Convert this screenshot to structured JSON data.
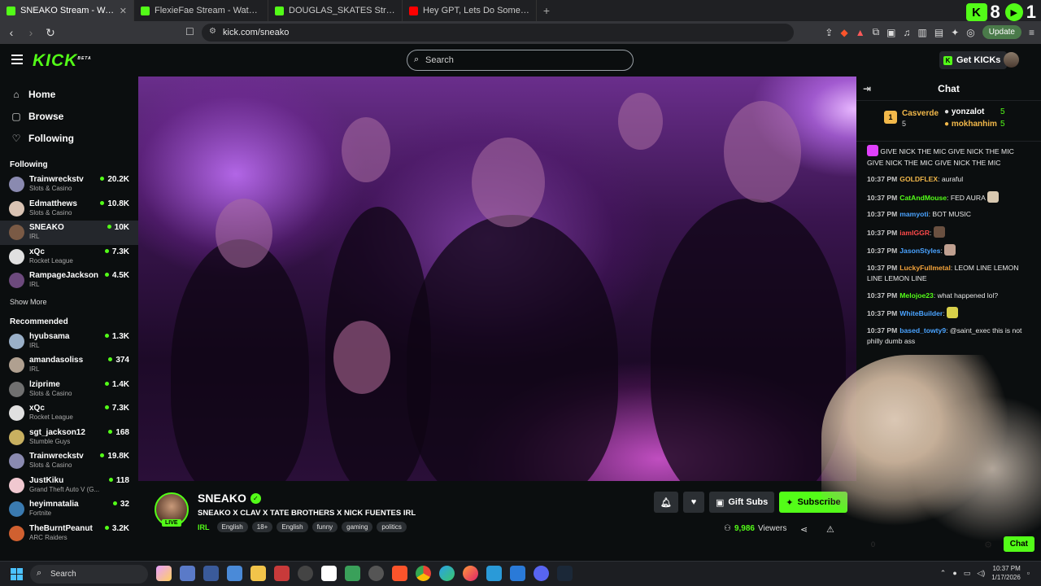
{
  "browser": {
    "tabs": [
      {
        "title": "SNEAKO Stream - Watch Live",
        "fav": "#53fc18",
        "active": true
      },
      {
        "title": "FlexieFae Stream - Watch Live on Kick",
        "fav": "#53fc18",
        "active": false
      },
      {
        "title": "DOUGLAS_SKATES Stream - Watch Live",
        "fav": "#53fc18",
        "active": false
      },
      {
        "title": "Hey GPT, Lets Do Some Riddles - YouTube",
        "fav": "#ff0000",
        "active": false
      }
    ],
    "url": "kick.com/sneako",
    "update_label": "Update",
    "overlay_kick_count": "8",
    "overlay_play_count": "1"
  },
  "header": {
    "logo": "KICK",
    "logo_sup": "BETA",
    "search_placeholder": "Search",
    "get_kicks_label": "Get KICKs"
  },
  "sidebar": {
    "nav": [
      {
        "label": "Home",
        "icon": "home-icon"
      },
      {
        "label": "Browse",
        "icon": "browse-icon"
      },
      {
        "label": "Following",
        "icon": "heart-icon"
      }
    ],
    "following_heading": "Following",
    "following": [
      {
        "name": "Trainwreckstv",
        "category": "Slots & Casino",
        "viewers": "20.2K",
        "color": "#8a8ab0"
      },
      {
        "name": "Edmatthews",
        "category": "Slots & Casino",
        "viewers": "10.8K",
        "color": "#d9c3b3"
      },
      {
        "name": "SNEAKO",
        "category": "IRL",
        "viewers": "10K",
        "color": "#7a5a45",
        "selected": true
      },
      {
        "name": "xQc",
        "category": "Rocket League",
        "viewers": "7.3K",
        "color": "#e0e0e0"
      },
      {
        "name": "RampageJackson",
        "category": "IRL",
        "viewers": "4.5K",
        "color": "#6d4a7d"
      }
    ],
    "show_more": "Show More",
    "recommended_heading": "Recommended",
    "recommended": [
      {
        "name": "hyubsama",
        "category": "IRL",
        "viewers": "1.3K",
        "color": "#9ab0c8"
      },
      {
        "name": "amandasoliss",
        "category": "IRL",
        "viewers": "374",
        "color": "#b0a090"
      },
      {
        "name": "lziprime",
        "category": "Slots & Casino",
        "viewers": "1.4K",
        "color": "#707070"
      },
      {
        "name": "xQc",
        "category": "Rocket League",
        "viewers": "7.3K",
        "color": "#e0e0e0"
      },
      {
        "name": "sgt_jackson12",
        "category": "Stumble Guys",
        "viewers": "168",
        "color": "#c8b060"
      },
      {
        "name": "Trainwreckstv",
        "category": "Slots & Casino",
        "viewers": "19.8K",
        "color": "#8a8ab0"
      },
      {
        "name": "JustKiku",
        "category": "Grand Theft Auto V (G...",
        "viewers": "118",
        "color": "#f0c8d0"
      },
      {
        "name": "heyimnatalia",
        "category": "Fortnite",
        "viewers": "32",
        "color": "#3a7ab0"
      },
      {
        "name": "TheBurntPeanut",
        "category": "ARC Raiders",
        "viewers": "3.2K",
        "color": "#d06030"
      }
    ]
  },
  "stream": {
    "name": "SNEAKO",
    "live_badge": "LIVE",
    "title": "SNEAKO X CLAV X TATE BROTHERS X NICK FUENTES IRL",
    "category": "IRL",
    "tags": [
      "English",
      "18+",
      "English",
      "funny",
      "gaming",
      "politics"
    ],
    "gift_subs_label": "Gift Subs",
    "subscribe_label": "Subscribe",
    "viewer_count": "9,986",
    "viewers_label": "Viewers"
  },
  "chat": {
    "title": "Chat",
    "top_gifter": {
      "rank": "1",
      "name": "Casverde",
      "count": "5"
    },
    "gifters": [
      {
        "name": "yonzalot",
        "count": "5"
      },
      {
        "name": "mokhanhim",
        "count": "5"
      }
    ],
    "messages": [
      {
        "time": "",
        "user": "",
        "color": "#fff",
        "text": "GIVE NICK THE MIC   GIVE NICK THE MIC   GIVE NICK THE MIC   GIVE NICK THE MIC",
        "emote": "#e040fb"
      },
      {
        "time": "10:37 PM",
        "user": "GOLDFLEX",
        "color": "#f2b84a",
        "text": "auraful"
      },
      {
        "time": "10:37 PM",
        "user": "CatAndMouse",
        "color": "#53fc18",
        "text": "FED AURA",
        "emote": "#d8c8b0"
      },
      {
        "time": "10:37 PM",
        "user": "mamyoti",
        "color": "#4aa3ff",
        "text": "BOT MUSIC"
      },
      {
        "time": "10:37 PM",
        "user": "iamIGGR",
        "color": "#ff4a4a",
        "text": "",
        "emote": "#6a5040"
      },
      {
        "time": "10:37 PM",
        "user": "JasonStyles",
        "color": "#4aa3ff",
        "text": "",
        "emote": "#c0a090"
      },
      {
        "time": "10:37 PM",
        "user": "LuckyFullmetal",
        "color": "#f2a23a",
        "text": "LEOM LINE LEMON LINE LEMON LINE"
      },
      {
        "time": "10:37 PM",
        "user": "Melojoe23",
        "color": "#53fc18",
        "text": "what happened lol?"
      },
      {
        "time": "10:37 PM",
        "user": "WhiteBuilder",
        "color": "#4aa3ff",
        "text": "",
        "emote": "#d8d04a"
      },
      {
        "time": "10:37 PM",
        "user": "based_towty9",
        "color": "#4aa3ff",
        "text": "@saint_exec this is not philly dumb ass"
      }
    ],
    "footer_count": "0",
    "chat_button": "Chat"
  },
  "taskbar": {
    "search_placeholder": "Search",
    "time": "10:37 PM",
    "date": "1/17/2026"
  }
}
